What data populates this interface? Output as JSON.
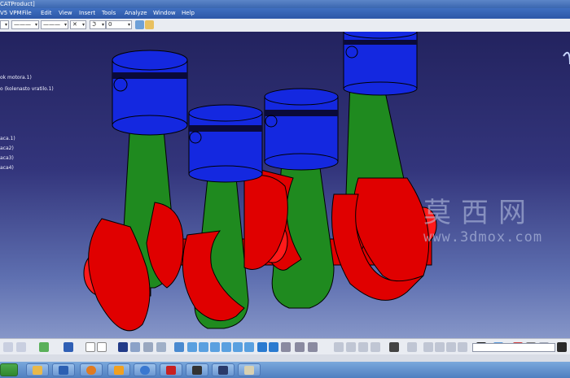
{
  "window": {
    "title": "CATProduct]"
  },
  "menu": [
    "V5 VPM",
    "File",
    "Edit",
    "View",
    "Insert",
    "Tools",
    "Analyze",
    "Window",
    "Help"
  ],
  "toolbar": {
    "line_type_value": "———",
    "line_weight_value": "———",
    "layer_value": "0"
  },
  "tree": {
    "items": [
      "ok motora.1)",
      "o (kolenasto vratilo.1)",
      "aca.1)",
      "aca2)",
      "aca3)",
      "aca4)"
    ]
  },
  "watermark": {
    "logo": "莫西网",
    "url": "www.3dmox.com"
  },
  "colors": {
    "piston": "#1428e0",
    "connecting_rod": "#1f8a1f",
    "crankshaft": "#e00000",
    "viewport_top": "#23235f",
    "viewport_bottom": "#8696c8"
  },
  "icons": {
    "toolbar": [
      "line-type-icon",
      "line-weight-icon",
      "point-style-icon",
      "layer-icon",
      "brush-icon"
    ],
    "bottom": [
      "fx-icon",
      "comment-icon",
      "spec-tree-icon",
      "fly-icon",
      "pan-icon",
      "rotate-icon",
      "zoom-in-icon",
      "zoom-out-icon",
      "normal-view-icon",
      "iso-view-icon",
      "shading-icon",
      "hide-show-icon",
      "swap-icon",
      "analysis-icon",
      "catalog-icon",
      "measure-icon",
      "material-icon"
    ],
    "taskbar": [
      "start-icon",
      "folder-icon",
      "firefox-icon",
      "inventor-icon",
      "ie-icon",
      "autocad-icon",
      "app-icon",
      "catia-icon",
      "brush-app-icon"
    ]
  }
}
